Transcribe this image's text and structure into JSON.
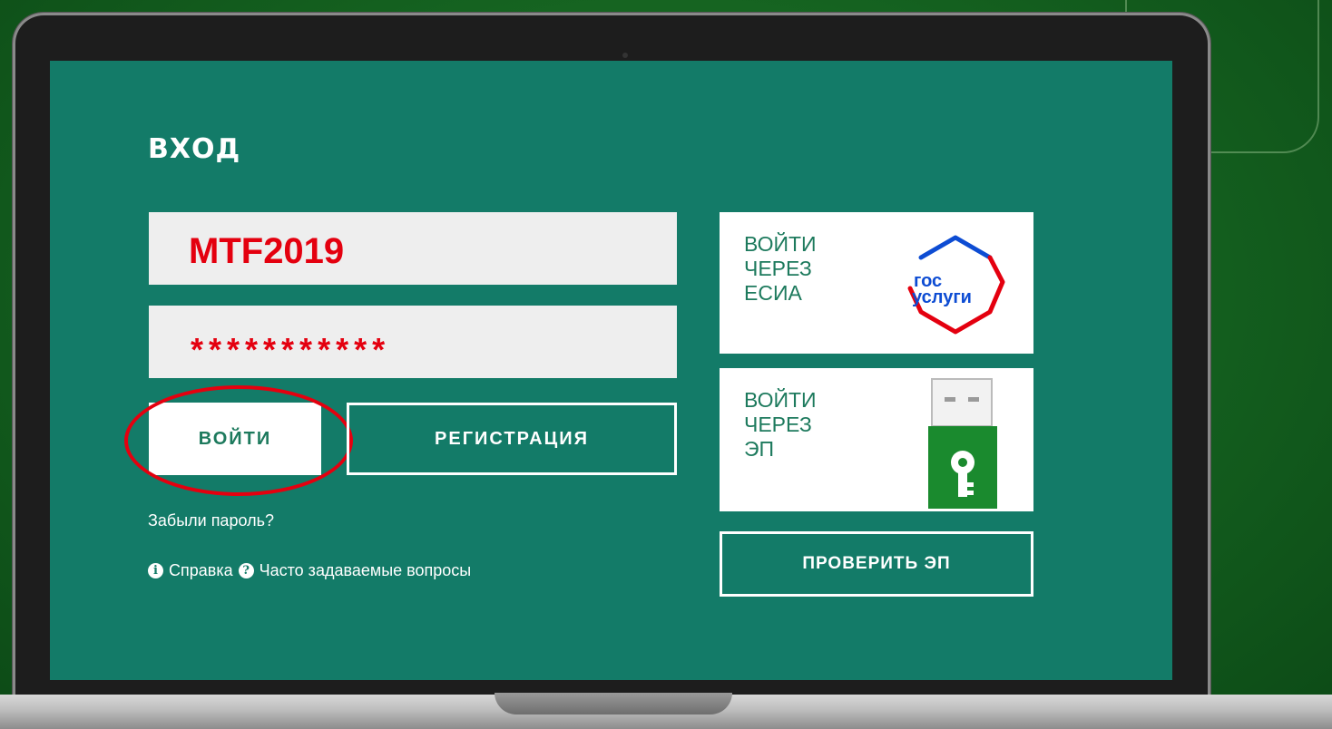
{
  "login": {
    "title": "ВХОД",
    "username_value": "MTF2019",
    "password_value": "***********",
    "login_button": "ВОЙТИ",
    "register_button": "РЕГИСТРАЦИЯ",
    "forgot_password": "Забыли пароль?",
    "help_link": "Справка",
    "faq_link": "Часто задаваемые вопросы"
  },
  "esia": {
    "line1": "ВОЙТИ",
    "line2": "ЧЕРЕЗ",
    "line3": "ЕСИА",
    "logo_top": "гос",
    "logo_bottom": "услуги"
  },
  "ep": {
    "line1": "ВОЙТИ",
    "line2": "ЧЕРЕЗ",
    "line3": "ЭП"
  },
  "check_ep_button": "ПРОВЕРИТЬ ЭП",
  "colors": {
    "screen_bg": "#137b68",
    "accent_text": "#1d7a5d",
    "highlight_red": "#e4000f",
    "gosuslugi_blue": "#0d4cd3",
    "usb_green": "#1a8a2e"
  },
  "icons": [
    "info-icon",
    "question-icon",
    "gosuslugi-logo",
    "usb-token-icon"
  ]
}
